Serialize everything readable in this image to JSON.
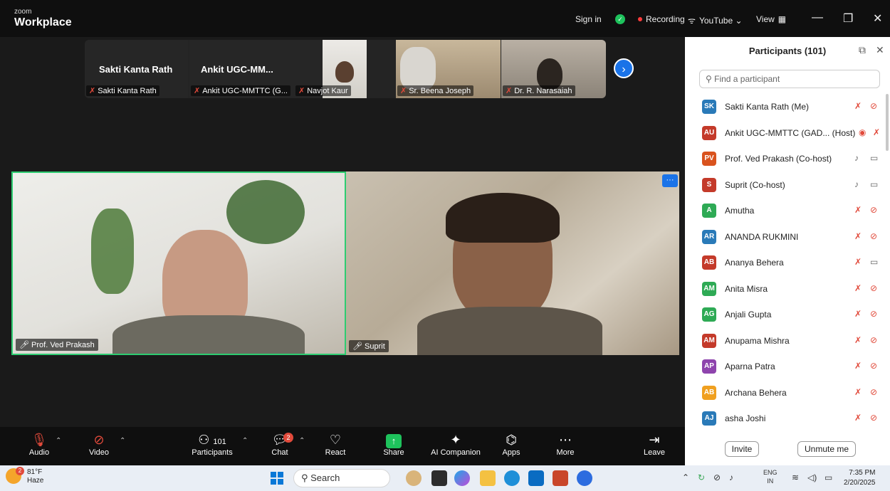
{
  "titlebar": {
    "brand_small": "zoom",
    "brand_big": "Workplace",
    "sign_in": "Sign in",
    "recording": "Recording",
    "youtube": "YouTube ⌄",
    "view": "View"
  },
  "strip": {
    "tiles": [
      {
        "name": "Sakti Kanta Rath",
        "label": "Sakti Kanta Rath"
      },
      {
        "name": "Ankit UGC-MM...",
        "label": "Ankit UGC-MMTTC (G..."
      },
      {
        "name": "",
        "label": "Navjot Kaur"
      },
      {
        "name": "",
        "label": "Sr. Beena Joseph"
      },
      {
        "name": "",
        "label": "Dr. R. Narasaiah"
      }
    ]
  },
  "videos": {
    "left_name": "Prof. Ved Prakash",
    "right_name": "Suprit"
  },
  "toolbar": {
    "audio": "Audio",
    "video": "Video",
    "participants": "Participants",
    "participants_count": "101",
    "chat": "Chat",
    "chat_badge": "2",
    "react": "React",
    "share": "Share",
    "ai": "AI Companion",
    "apps": "Apps",
    "more": "More",
    "leave": "Leave"
  },
  "panel": {
    "title": "Participants (101)",
    "search_placeholder": "Find a participant",
    "participants": [
      {
        "initials": "SK",
        "name": "Sakti Kanta Rath (Me)",
        "color": "#2a7ab8"
      },
      {
        "initials": "AU",
        "name": "Ankit UGC-MMTTC (GAD... (Host)",
        "color": "#c43a2a"
      },
      {
        "initials": "PV",
        "name": "Prof. Ved Prakash (Co-host)",
        "color": "#d9531e"
      },
      {
        "initials": "S",
        "name": "Suprit (Co-host)",
        "color": "#c43a2a"
      },
      {
        "initials": "A",
        "name": "Amutha",
        "color": "#2eaa55"
      },
      {
        "initials": "AR",
        "name": "ANANDA RUKMINI",
        "color": "#2a7ab8"
      },
      {
        "initials": "AB",
        "name": "Ananya Behera",
        "color": "#c43a2a"
      },
      {
        "initials": "AM",
        "name": "Anita Misra",
        "color": "#2eaa55"
      },
      {
        "initials": "AG",
        "name": "Anjali Gupta",
        "color": "#2eaa55"
      },
      {
        "initials": "AM",
        "name": "Anupama Mishra",
        "color": "#c43a2a"
      },
      {
        "initials": "AP",
        "name": "Aparna Patra",
        "color": "#8e44ad"
      },
      {
        "initials": "AB",
        "name": "Archana Behera",
        "color": "#f0a020"
      },
      {
        "initials": "AJ",
        "name": "asha Joshi",
        "color": "#2a7ab8"
      }
    ],
    "invite": "Invite",
    "unmute": "Unmute me"
  },
  "taskbar": {
    "weather_badge": "2",
    "temp": "81°F",
    "condition": "Haze",
    "search": "Search",
    "lang_top": "ENG",
    "lang_bottom": "IN",
    "time": "7:35 PM",
    "date": "2/20/2025"
  }
}
